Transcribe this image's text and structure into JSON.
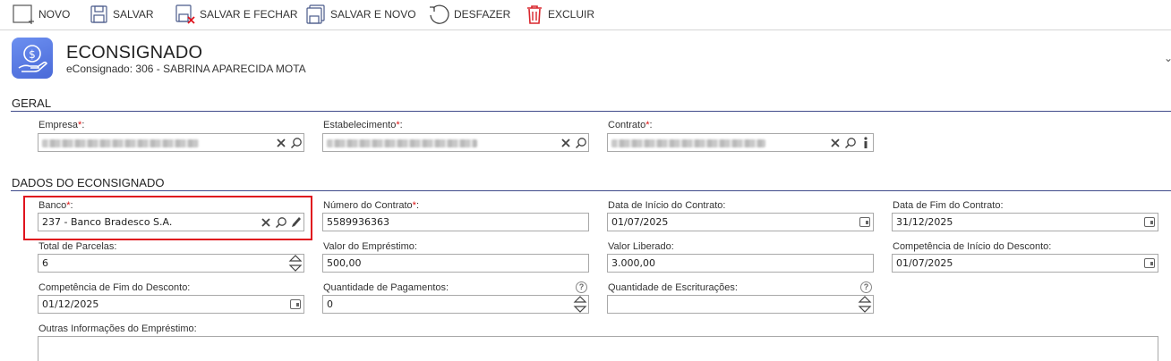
{
  "toolbar": {
    "novo": "NOVO",
    "salvar": "SALVAR",
    "salvar_fechar": "SALVAR E FECHAR",
    "salvar_novo": "SALVAR E NOVO",
    "desfazer": "DESFAZER",
    "excluir": "EXCLUIR"
  },
  "header": {
    "title": "ECONSIGNADO",
    "subtitle": "eConsignado: 306 - SABRINA APARECIDA MOTA",
    "icon": "money-hand-icon"
  },
  "sections": {
    "geral": "GERAL",
    "dados": "DADOS DO ECONSIGNADO"
  },
  "geral": {
    "empresa_label": "Empresa",
    "estabelecimento_label": "Estabelecimento",
    "contrato_label": "Contrato",
    "required_mark": "*",
    "colon": ":"
  },
  "dados": {
    "banco_label": "Banco",
    "banco_value": "237 - Banco Bradesco S.A.",
    "numero_contrato_label": "Número do Contrato",
    "numero_contrato_value": "5589936363",
    "data_inicio_label": "Data de Início do Contrato:",
    "data_inicio_value": "01/07/2025",
    "data_fim_label": "Data de Fim do Contrato:",
    "data_fim_value": "31/12/2025",
    "total_parcelas_label": "Total de Parcelas:",
    "total_parcelas_value": "6",
    "valor_emprestimo_label": "Valor do Empréstimo:",
    "valor_emprestimo_value": "500,00",
    "valor_liberado_label": "Valor Liberado:",
    "valor_liberado_value": "3.000,00",
    "comp_inicio_label": "Competência de Início do Desconto:",
    "comp_inicio_value": "01/07/2025",
    "comp_fim_label": "Competência de Fim do Desconto:",
    "comp_fim_value": "01/12/2025",
    "qtd_pagamentos_label": "Quantidade de Pagamentos:",
    "qtd_pagamentos_value": "0",
    "qtd_escrituracoes_label": "Quantidade de Escriturações:",
    "qtd_escrituracoes_value": "",
    "outras_info_label": "Outras Informações do Empréstimo:",
    "help_mark": "?"
  },
  "colors": {
    "accent_line": "#3f4a8a",
    "required": "#dd1111",
    "highlight": "#e0141e",
    "icon_bg": "#5a7ae0"
  }
}
